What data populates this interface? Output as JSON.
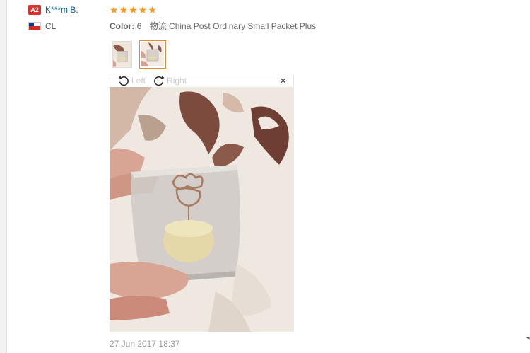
{
  "user": {
    "level_badge": "A2",
    "username": "K***m B.",
    "country": "CL"
  },
  "review": {
    "stars": [
      "★",
      "★",
      "★",
      "★",
      "★"
    ],
    "rating": 5,
    "color_label": "Color:",
    "color_value": "6",
    "shipping": "物流 China Post Ordinary Small Packet Plus",
    "date": "27 Jun 2017 18:37"
  },
  "viewer": {
    "rotate_left_label": "Left",
    "rotate_right_label": "Right",
    "close_symbol": "×"
  },
  "colors": {
    "star": "#f29a1f",
    "username": "#0a5f98",
    "badge": "#d9342b",
    "active_thumb_border": "#e08b2f"
  }
}
